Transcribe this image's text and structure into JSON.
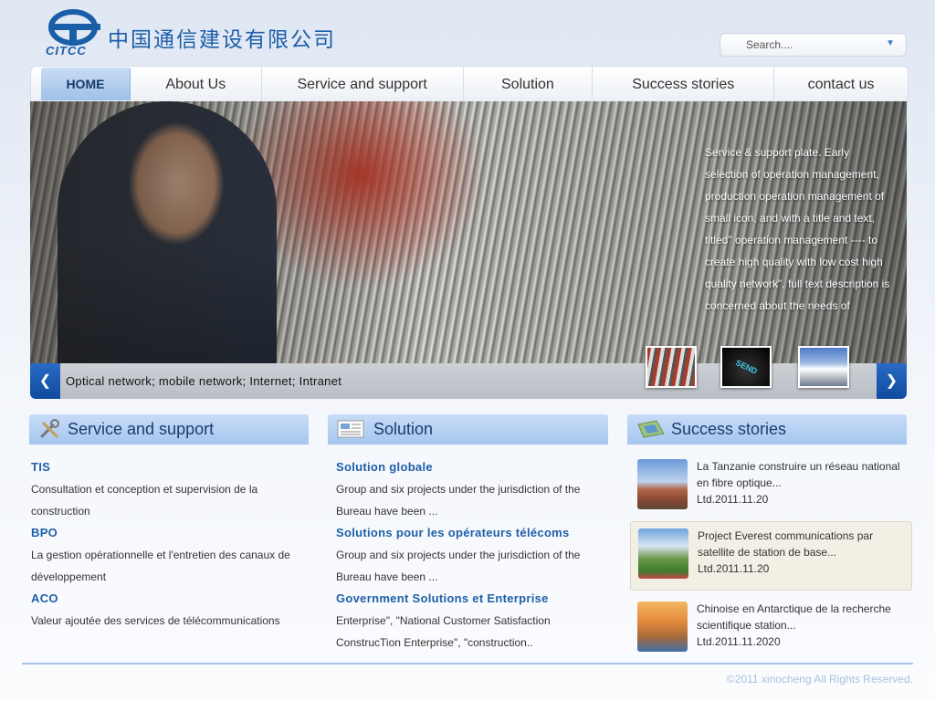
{
  "header": {
    "logo_text": "CITCC",
    "company_cn": "中国通信建设有限公司",
    "search_placeholder": "Search...."
  },
  "nav": {
    "items": [
      "HOME",
      "About Us",
      "Service and support",
      "Solution",
      "Success stories",
      "contact us"
    ]
  },
  "banner": {
    "text": "Service & support plate. Early selection of operation management, production operation management of small icon, and with a title and text, titled\" operation management ---- to create high quality with low cost high quality network\", full text description is concerned about the needs of",
    "caption": "Optical network; mobile network; Internet; Intranet",
    "thumb2_label": "SEND"
  },
  "service": {
    "title": "Service and support",
    "entries": [
      {
        "title": "TIS",
        "desc": "Consultation et conception et supervision de la construction"
      },
      {
        "title": "BPO",
        "desc": "La gestion opérationnelle et l'entretien des canaux de développement"
      },
      {
        "title": "ACO",
        "desc": "Valeur ajoutée des services de télécommunications"
      }
    ]
  },
  "solution": {
    "title": "Solution",
    "entries": [
      {
        "title": "Solution globale",
        "desc": "Group and six projects under the jurisdiction of the Bureau have been ..."
      },
      {
        "title": "Solutions pour les opérateurs télécoms",
        "desc": "Group and six projects under the jurisdiction of the Bureau have been ..."
      },
      {
        "title": "Government Solutions et Enterprise",
        "desc": "Enterprise\", \"National Customer Satisfaction ConstrucTion Enterprise\", \"construction.."
      }
    ]
  },
  "stories": {
    "title": "Success stories",
    "items": [
      {
        "text": "La Tanzanie construire un réseau national en fibre optique...",
        "date": "Ltd.2011.11.20"
      },
      {
        "text": "Project Everest communications par satellite de station de base...",
        "date": "Ltd.2011.11.20"
      },
      {
        "text": "Chinoise en Antarctique de la recherche scientifique station...",
        "date": "Ltd.2011.11.2020"
      }
    ]
  },
  "footer": {
    "copyright": "©2011 xinocheng All Rights Reserved."
  },
  "colors": {
    "brand_blue": "#1b5ea8",
    "link_blue": "#1f5fa8",
    "nav_active": "#9fc1ea",
    "section_header": "#b6d1f3",
    "highlight_row": "#f2efe4"
  },
  "icons": {
    "search_dropdown": "chevron-down-icon",
    "banner_prev": "arrow-left-icon",
    "banner_next": "arrow-right-icon",
    "service": "tools-icon",
    "solution": "newspaper-icon",
    "stories": "map-icon"
  }
}
